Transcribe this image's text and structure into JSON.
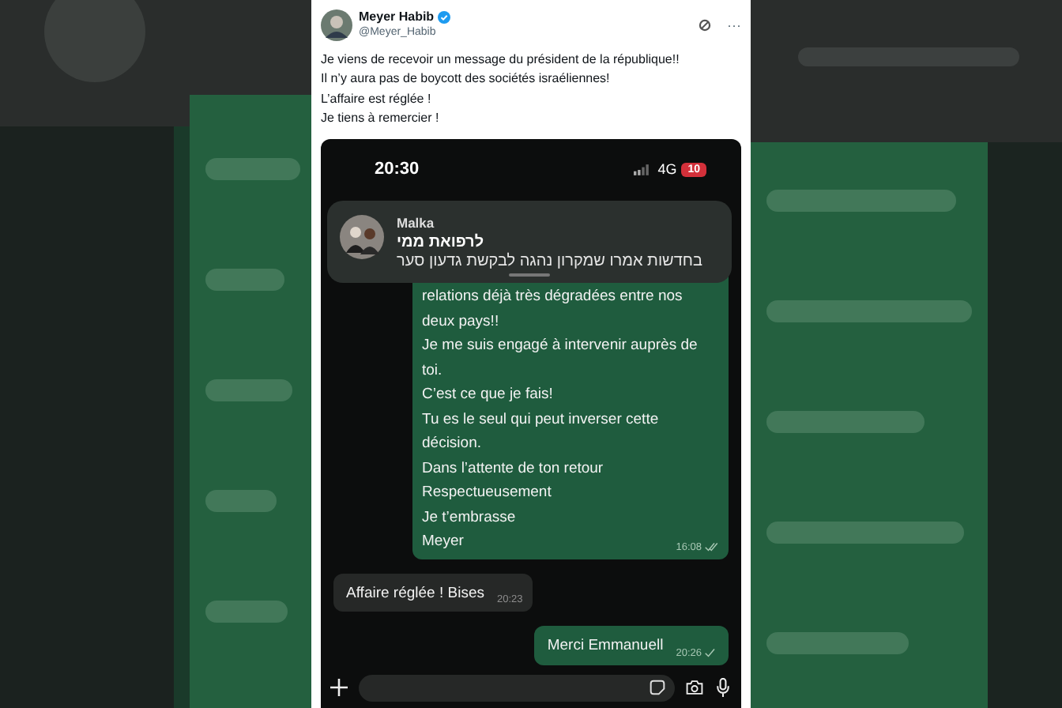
{
  "tweet": {
    "author": "Meyer Habib",
    "verified": true,
    "handle": "@Meyer_Habib",
    "more": "···",
    "lines": [
      "Je viens de recevoir un message du président de la république!!",
      "Il n’y aura pas de boycott des sociétés israéliennes!",
      "L’affaire est réglée !",
      "Je tiens à remercier !"
    ]
  },
  "phone": {
    "status_bar": {
      "time": "20:30",
      "network": "4G",
      "battery": "10"
    },
    "notification": {
      "sender": "Malka",
      "title": "לרפואת ממי",
      "preview": "בחדשות אמרו שמקרון נהגה לבקשת גדעון סער"
    },
    "messages": [
      {
        "kind": "outgoing",
        "lines": [
          "relations déjà très dégradées entre nos",
          "deux pays!!",
          "Je me suis engagé à intervenir auprès de",
          "toi.",
          "C’est ce que je fais!",
          "Tu es le seul qui peut inverser cette",
          "décision.",
          "Dans l’attente de ton retour",
          "Respectueusement",
          "Je t’embrasse",
          "Meyer"
        ],
        "time": "16:08",
        "read": true
      },
      {
        "kind": "incoming",
        "lines": [
          "Affaire réglée ! Bises"
        ],
        "time": "20:23"
      },
      {
        "kind": "outgoing",
        "lines": [
          "Merci Emmanuell"
        ],
        "time": "20:26",
        "read": false
      }
    ]
  }
}
